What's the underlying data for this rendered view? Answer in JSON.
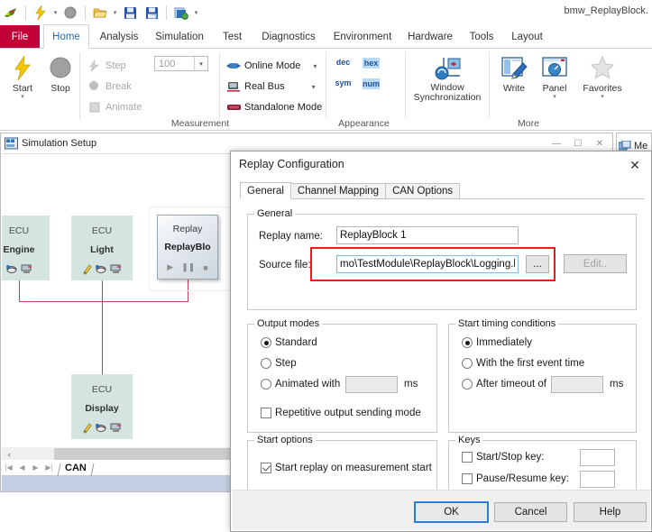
{
  "app": {
    "title": "bmw_ReplayBlock.",
    "quick_access": [
      {
        "name": "canoe-logo-icon",
        "glyph": "✈"
      },
      {
        "name": "start-measurement-icon",
        "glyph": "⚡"
      },
      {
        "name": "start-dropdown-caret",
        "glyph": "▾"
      },
      {
        "name": "stop-measurement-icon",
        "glyph": "⬤"
      },
      {
        "name": "open-file-icon",
        "glyph": "📂"
      },
      {
        "name": "open-dropdown-caret",
        "glyph": "▾"
      },
      {
        "name": "save-icon",
        "glyph": "💾"
      },
      {
        "name": "save-as-icon",
        "glyph": "💾"
      },
      {
        "name": "save-all-icon",
        "glyph": "🗗"
      },
      {
        "name": "customize-qat-caret",
        "glyph": "▾"
      }
    ]
  },
  "ribbon": {
    "tabs": [
      {
        "label": "File",
        "active": false,
        "file": true
      },
      {
        "label": "Home",
        "active": true
      },
      {
        "label": "Analysis",
        "active": false
      },
      {
        "label": "Simulation",
        "active": false
      },
      {
        "label": "Test",
        "active": false
      },
      {
        "label": "Diagnostics",
        "active": false
      },
      {
        "label": "Environment",
        "active": false
      },
      {
        "label": "Hardware",
        "active": false
      },
      {
        "label": "Tools",
        "active": false
      },
      {
        "label": "Layout",
        "active": false
      }
    ],
    "groups": [
      {
        "name": "measurement",
        "label": "Measurement"
      },
      {
        "name": "appearance",
        "label": "Appearance"
      },
      {
        "name": "more",
        "label": "More"
      }
    ],
    "measurement": {
      "start_label": "Start",
      "stop_label": "Stop",
      "step_label": "Step",
      "break_label": "Break",
      "animate_label": "Animate",
      "step_value": "100",
      "online_mode_label": "Online Mode",
      "real_bus_label": "Real Bus",
      "standalone_mode_label": "Standalone Mode"
    },
    "appearance": {
      "dec": "dec",
      "hex": "hex",
      "sym": "sym",
      "num": "num",
      "highlighted": [
        "hex",
        "num"
      ]
    },
    "more": {
      "window_sync_line1": "Window",
      "window_sync_line2": "Synchronization",
      "write_label": "Write",
      "panel_label": "Panel",
      "favorites_label": "Favorites"
    }
  },
  "simulation_setup": {
    "title": "Simulation Setup",
    "window_controls": [
      "minimize",
      "maximize",
      "close"
    ],
    "nodes": [
      {
        "name": "ecu-engine",
        "type": "ECU",
        "label": "Engine"
      },
      {
        "name": "ecu-light",
        "type": "ECU",
        "label": "Light"
      },
      {
        "name": "ecu-display",
        "type": "ECU",
        "label": "Display"
      },
      {
        "name": "replay-block",
        "type": "Replay",
        "label": "ReplayBlo"
      }
    ],
    "bus_tab": "CAN",
    "scroll_left_glyph": "‹"
  },
  "background_window": {
    "title": "Me"
  },
  "dialog": {
    "title": "Replay Configuration",
    "close_glyph": "✕",
    "tabs": [
      {
        "label": "General",
        "active": true
      },
      {
        "label": "Channel Mapping",
        "active": false
      },
      {
        "label": "CAN Options",
        "active": false
      }
    ],
    "general_group": {
      "legend": "General",
      "replay_name_label": "Replay name:",
      "replay_name_value": "ReplayBlock 1",
      "source_file_label": "Source file:",
      "source_file_value": "mo\\TestModule\\ReplayBlock\\Logging.blf",
      "browse_label": "...",
      "edit_label": "Edit..",
      "edit_disabled": true,
      "highlight_color": "#e81c1c"
    },
    "output_modes": {
      "legend": "Output modes",
      "options": [
        {
          "label": "Standard",
          "selected": true
        },
        {
          "label": "Step",
          "selected": false
        },
        {
          "label": "Animated with",
          "selected": false
        }
      ],
      "animated_value": "",
      "animated_unit": "ms",
      "repetitive_label": "Repetitive output sending mode",
      "repetitive_checked": false
    },
    "start_timing": {
      "legend": "Start timing conditions",
      "options": [
        {
          "label": "Immediately",
          "selected": true
        },
        {
          "label": "With the first event time",
          "selected": false
        },
        {
          "label": "After timeout of",
          "selected": false
        }
      ],
      "timeout_value": "",
      "timeout_unit": "ms"
    },
    "start_options": {
      "legend": "Start options",
      "checkbox_label": "Start replay on measurement start",
      "checked": true
    },
    "keys": {
      "legend": "Keys",
      "start_stop_label": "Start/Stop key:",
      "start_stop_checked": false,
      "start_stop_value": "",
      "pause_resume_label": "Pause/Resume key:",
      "pause_resume_checked": false,
      "pause_resume_value": ""
    },
    "buttons": {
      "ok": "OK",
      "cancel": "Cancel",
      "help": "Help"
    }
  }
}
